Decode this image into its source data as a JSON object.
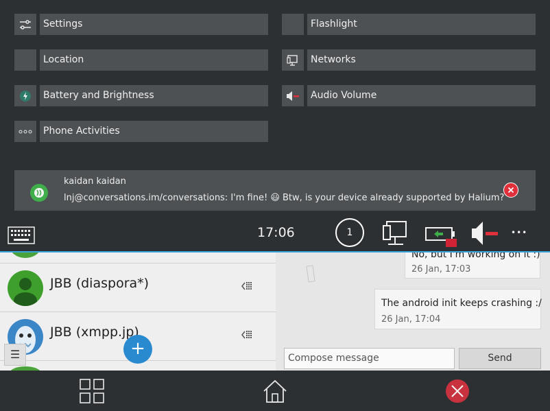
{
  "quick_settings": {
    "tiles": [
      {
        "label": "Settings",
        "icon": "settings-sliders-icon"
      },
      {
        "label": "Flashlight",
        "icon": "flashlight-icon"
      },
      {
        "label": "Location",
        "icon": "location-icon"
      },
      {
        "label": "Networks",
        "icon": "network-wired-icon"
      },
      {
        "label": "Battery and Brightness",
        "icon": "battery-charging-icon"
      },
      {
        "label": "Audio Volume",
        "icon": "audio-muted-icon"
      },
      {
        "label": "Phone Activities",
        "icon": "more-dots-icon"
      }
    ]
  },
  "notification": {
    "app_icon": "conversations-app-icon",
    "title": "kaidan kaidan",
    "body": "lnj@conversations.im/conversations: I'm fine! 😃 Btw, is your device already supported by Halium?"
  },
  "status_bar": {
    "time": "17:06",
    "notification_count": "1",
    "more": "•••"
  },
  "roster": {
    "contacts": [
      {
        "name": "JBB (diaspora*)"
      },
      {
        "name": "JBB (xmpp.jp)"
      }
    ]
  },
  "chat": {
    "messages": [
      {
        "text": "No, but I'm working on it :)",
        "time": "26 Jan, 17:03"
      },
      {
        "text": "The android init keeps crashing :/",
        "time": "26 Jan, 17:04"
      }
    ],
    "compose_placeholder": "Compose message",
    "send_label": "Send",
    "fab_label": "+",
    "drawer_label": "☰"
  },
  "colors": {
    "panel_bg": "#2d3033",
    "tile_bg": "#4d5154",
    "accent": "#3aa0d9",
    "close_red": "#e0303b",
    "fab_blue": "#2a8ad0"
  }
}
